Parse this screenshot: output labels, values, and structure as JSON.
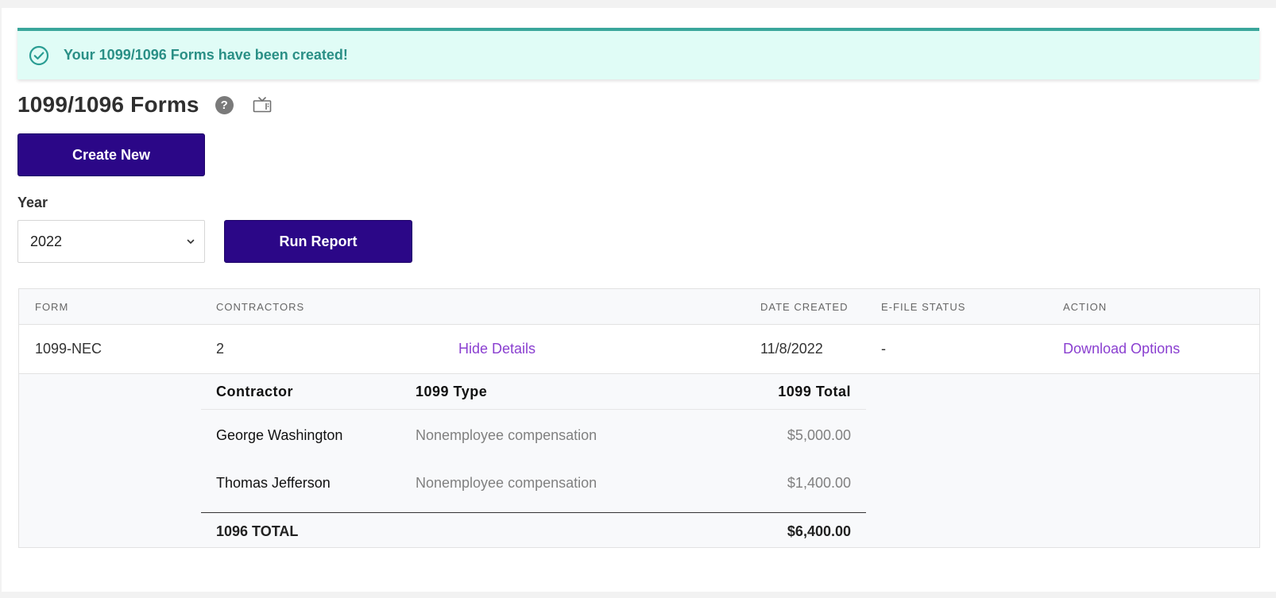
{
  "banner": {
    "message": "Your 1099/1096 Forms have been created!",
    "icon": "check-circle-icon",
    "color": "#2a8f86",
    "background": "#e0fcf6"
  },
  "header": {
    "title": "1099/1096 Forms",
    "help_icon_glyph": "?",
    "help_icon": "help-icon",
    "video_icon": "tv-icon"
  },
  "actions": {
    "create_new_label": "Create New",
    "run_report_label": "Run Report",
    "accent": "#2b0787"
  },
  "filters": {
    "year_label": "Year",
    "year_value": "2022",
    "year_chevron": "⌄"
  },
  "table": {
    "columns": [
      "FORM",
      "CONTRACTORS",
      "DATE CREATED",
      "E-FILE STATUS",
      "ACTION"
    ],
    "rows": [
      {
        "form": "1099-NEC",
        "contractors": "2",
        "details_link": "Hide Details",
        "date_created": "11/8/2022",
        "efile_status": "-",
        "action_link": "Download Options"
      }
    ],
    "link_color": "#8a3fd0"
  },
  "details": {
    "columns": [
      "Contractor",
      "1099 Type",
      "1099 Total"
    ],
    "rows": [
      {
        "contractor": "George Washington",
        "type": "Nonemployee compensation",
        "total": "$5,000.00"
      },
      {
        "contractor": "Thomas Jefferson",
        "type": "Nonemployee compensation",
        "total": "$1,400.00"
      }
    ],
    "total_label": "1096 TOTAL",
    "total_value": "$6,400.00"
  }
}
